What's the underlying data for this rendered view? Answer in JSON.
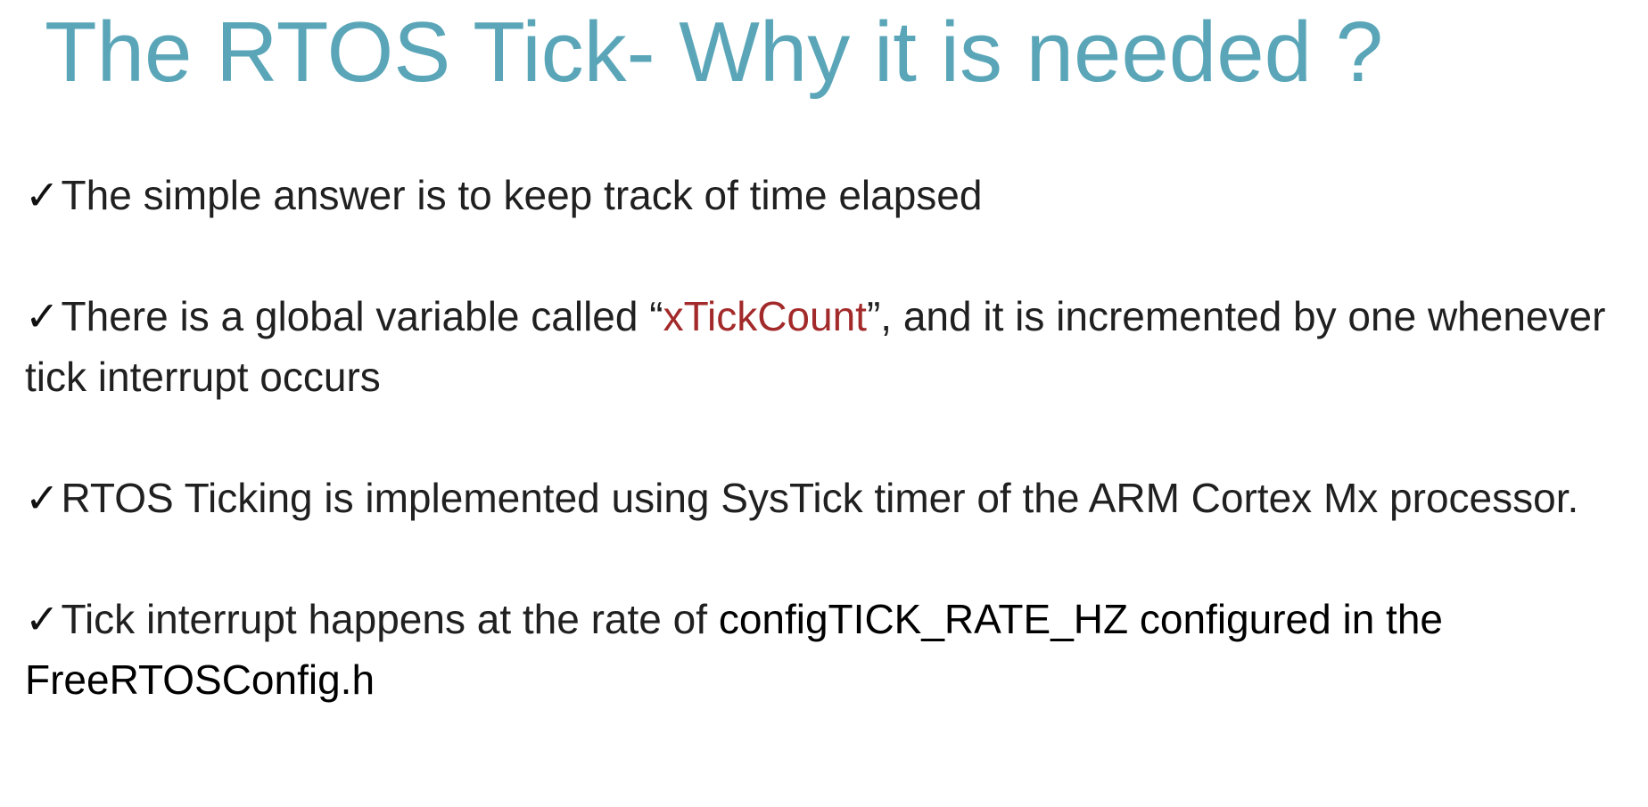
{
  "slide": {
    "title": "The RTOS Tick- Why it is needed ?",
    "check_symbol": "✓",
    "bullets": [
      {
        "text": "The simple answer is to keep track of time elapsed"
      },
      {
        "before": "There is a global variable called “",
        "highlight": "xTickCount",
        "after": "”, and  it is incremented by one whenever  tick interrupt occurs"
      },
      {
        "text": "RTOS Ticking is implemented using SysTick timer of the ARM Cortex Mx processor."
      },
      {
        "before": "Tick interrupt happens at the rate of ",
        "emphasis": "configTICK_RATE_HZ  configured in the FreeRTOSConfig.h"
      }
    ]
  },
  "colors": {
    "title": "#5aa6b8",
    "body_text": "#202020",
    "highlight": "#a32a2a",
    "background": "#ffffff"
  }
}
